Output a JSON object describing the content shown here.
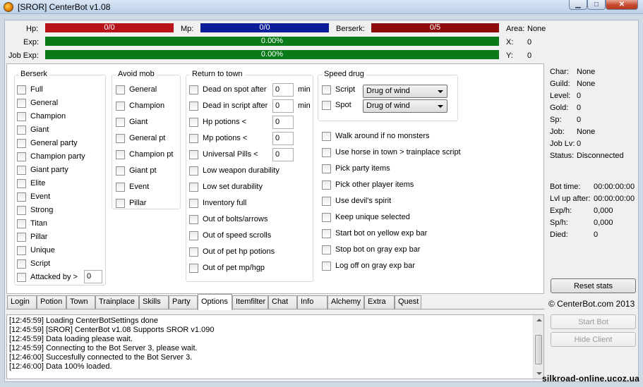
{
  "window": {
    "title": "[SROR] CenterBot v1.08"
  },
  "status": {
    "hp_label": "Hp:",
    "hp_value": "0/0",
    "mp_label": "Mp:",
    "mp_value": "0/0",
    "berserk_label": "Berserk:",
    "berserk_value": "0/5",
    "exp_label": "Exp:",
    "exp_value": "0.00%",
    "jobexp_label": "Job Exp:",
    "jobexp_value": "0.00%",
    "area_label": "Area:",
    "area_value": "None",
    "x_label": "X:",
    "x_value": "0",
    "y_label": "Y:",
    "y_value": "0"
  },
  "berserk_group": {
    "title": "Berserk",
    "items": [
      "Full",
      "General",
      "Champion",
      "Giant",
      "General party",
      "Champion party",
      "Giant party",
      "Elite",
      "Event",
      "Strong",
      "Titan",
      "Pillar",
      "Unique",
      "Script",
      "Attacked by >"
    ],
    "attacked_value": "0"
  },
  "avoid_group": {
    "title": "Avoid mob",
    "items": [
      "General",
      "Champion",
      "Giant",
      "General pt",
      "Champion pt",
      "Giant pt",
      "Event",
      "Pillar"
    ]
  },
  "return_group": {
    "title": "Return to town",
    "items": [
      "Dead on spot after",
      "Dead in script after",
      "Hp potions <",
      "Mp potions <",
      "Universal Pills <",
      "Low weapon durability",
      "Low set durability",
      "Inventory full",
      "Out of bolts/arrows",
      "Out of speed scrolls",
      "Out of pet hp potions",
      "Out of pet mp/hgp"
    ],
    "values": [
      "0",
      "0",
      "0",
      "0",
      "0"
    ],
    "min_label": "min"
  },
  "speed_group": {
    "title": "Speed drug",
    "script_label": "Script",
    "script_select": "Drug of wind",
    "spot_label": "Spot",
    "spot_select": "Drug of wind"
  },
  "misc_options": [
    "Walk around if no monsters",
    "Use horse in town > trainplace script",
    "Pick party items",
    "Pick other player items",
    "Use devil's spirit",
    "Keep unique selected",
    "Start bot on yellow exp bar",
    "Stop bot on gray exp bar",
    "Log off on gray exp bar"
  ],
  "char_info": {
    "char_label": "Char:",
    "char_value": "None",
    "guild_label": "Guild:",
    "guild_value": "None",
    "level_label": "Level:",
    "level_value": "0",
    "gold_label": "Gold:",
    "gold_value": "0",
    "sp_label": "Sp:",
    "sp_value": "0",
    "job_label": "Job:",
    "job_value": "None",
    "joblv_label": "Job Lv:",
    "joblv_value": "0",
    "status_label": "Status:",
    "status_value": "Disconnected"
  },
  "stats": {
    "bottime_label": "Bot time:",
    "bottime_value": "00:00:00:00",
    "lvlup_label": "Lvl up after:",
    "lvlup_value": "00:00:00:00",
    "exph_label": "Exp/h:",
    "exph_value": "0,000",
    "sph_label": "Sp/h:",
    "sph_value": "0,000",
    "died_label": "Died:",
    "died_value": "0"
  },
  "buttons": {
    "reset_stats": "Reset stats",
    "copyright": "© CenterBot.com 2013",
    "start_bot": "Start Bot",
    "hide_client": "Hide Client"
  },
  "tabs": [
    "Login",
    "Potion",
    "Town",
    "Trainplace",
    "Skills",
    "Party",
    "Options",
    "Itemfilter",
    "Chat",
    "Info",
    "Alchemy",
    "Extra",
    "Quest"
  ],
  "active_tab": "Options",
  "log": [
    "[12:45:59] Loading CenterBotSettings done",
    "[12:45:59] [SROR] CenterBot v1.08 Supports SROR v1.090",
    "[12:45:59] Data loading please wait.",
    "[12:45:59] Connecting to the Bot Server 3, please wait.",
    "[12:46:00] Succesfully connected to the Bot Server 3.",
    "[12:46:00] Data 100% loaded."
  ],
  "watermark": "silkroad-online.ucoz.ua"
}
